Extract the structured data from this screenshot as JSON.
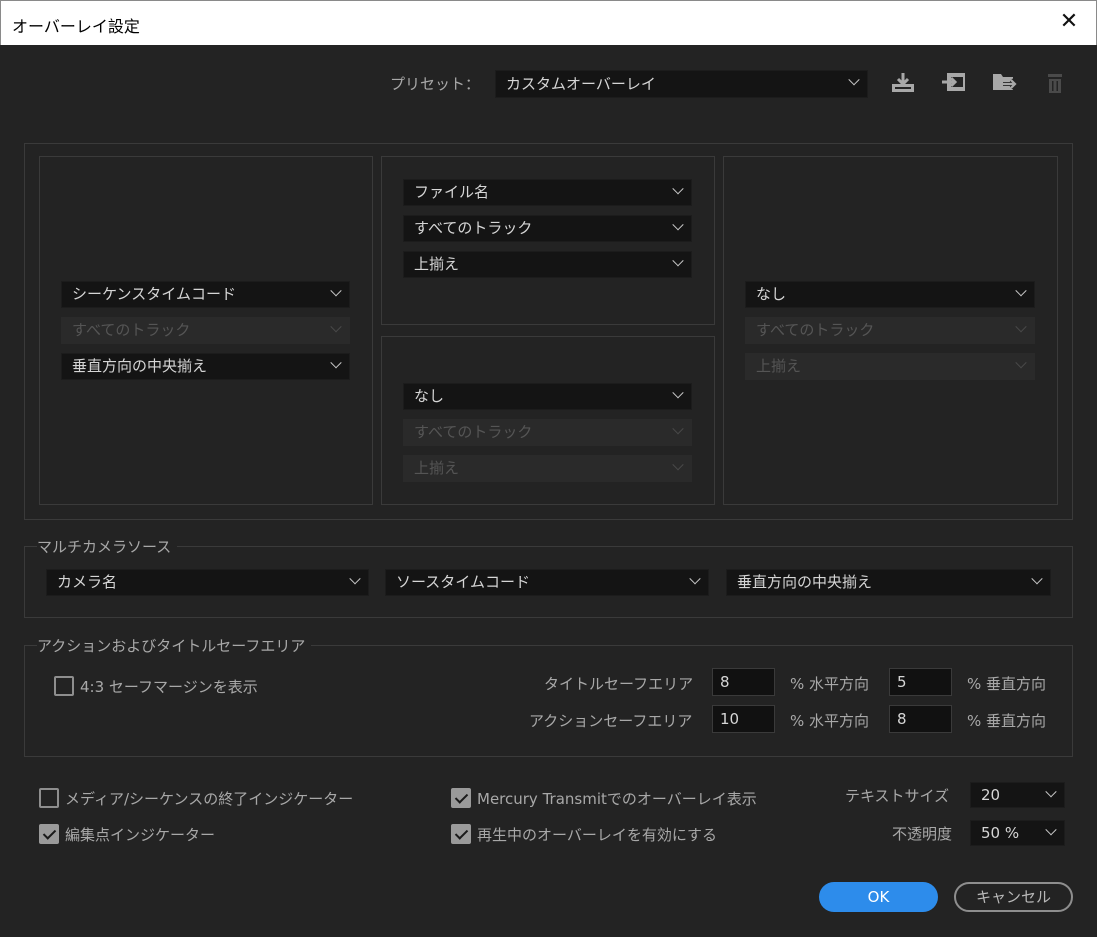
{
  "window": {
    "title": "オーバーレイ設定"
  },
  "preset": {
    "label": "プリセット：",
    "value": "カスタムオーバーレイ",
    "icons": [
      "save-preset-icon",
      "import-preset-icon",
      "export-preset-icon",
      "delete-preset-icon"
    ]
  },
  "overlay": {
    "left": {
      "source": "シーケンスタイムコード",
      "track": "すべてのトラック",
      "align": "垂直方向の中央揃え"
    },
    "center_top": {
      "source": "ファイル名",
      "track": "すべてのトラック",
      "align": "上揃え"
    },
    "center_bottom": {
      "source": "なし",
      "track": "すべてのトラック",
      "align": "上揃え"
    },
    "right": {
      "source": "なし",
      "track": "すべてのトラック",
      "align": "上揃え"
    }
  },
  "multicam": {
    "label": "マルチカメラソース",
    "camera": "カメラ名",
    "timecode": "ソースタイムコード",
    "align": "垂直方向の中央揃え"
  },
  "safe_area": {
    "label": "アクションおよびタイトルセーフエリア",
    "show_43": "4:3 セーフマージンを表示",
    "title_label": "タイトルセーフエリア",
    "title_h": "8",
    "title_v": "5",
    "action_label": "アクションセーフエリア",
    "action_h": "10",
    "action_v": "8",
    "pct_h": "% 水平方向",
    "pct_v": "% 垂直方向"
  },
  "options": {
    "media_end": "メディア/シーケンスの終了インジケーター",
    "edit_point": "編集点インジケーター",
    "mercury": "Mercury  Transmitでのオーバーレイ表示",
    "playback": "再生中のオーバーレイを有効にする",
    "text_size_label": "テキストサイズ",
    "text_size": "20",
    "opacity_label": "不透明度",
    "opacity": "50 %"
  },
  "buttons": {
    "ok": "OK",
    "cancel": "キャンセル"
  }
}
